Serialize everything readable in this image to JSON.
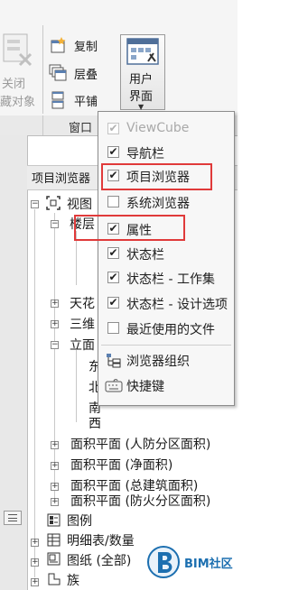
{
  "ribbon": {
    "close_hidden_line1": "关闭",
    "close_hidden_line2": "藏对象",
    "copy": "复制",
    "cascade": "层叠",
    "tile": "平铺",
    "ui_line1": "用户",
    "ui_line2": "界面",
    "panel_window": "窗口"
  },
  "browser": {
    "header": "项目浏览器",
    "items": {
      "views": "视图",
      "floor_plans_partial": "楼层",
      "ceiling_partial": "天花",
      "threeD_partial": "三维",
      "elevations_partial": "立面",
      "elev_e": "东",
      "elev_n": "北",
      "elev_s": "南",
      "elev_w": "西",
      "area_civil": "面积平面 (人防分区面积)",
      "area_net": "面积平面 (净面积)",
      "area_gross": "面积平面 (总建筑面积)",
      "area_fire": "面积平面 (防火分区面积)",
      "legends": "图例",
      "schedules": "明细表/数量",
      "sheets": "图纸 (全部)",
      "families": "族"
    }
  },
  "menu": {
    "items": [
      {
        "label": "ViewCube",
        "checked": true,
        "enabled": false
      },
      {
        "label": "导航栏",
        "checked": true,
        "enabled": true
      },
      {
        "label": "项目浏览器",
        "checked": true,
        "enabled": true
      },
      {
        "label": "系统浏览器",
        "checked": false,
        "enabled": true
      },
      {
        "label": "属性",
        "checked": true,
        "enabled": true
      },
      {
        "label": "状态栏",
        "checked": true,
        "enabled": true
      },
      {
        "label": "状态栏 - 工作集",
        "checked": true,
        "enabled": true
      },
      {
        "label": "状态栏 - 设计选项",
        "checked": true,
        "enabled": true
      },
      {
        "label": "最近使用的文件",
        "checked": false,
        "enabled": true
      }
    ],
    "browser_org": "浏览器组织",
    "shortcuts": "快捷键",
    "check_glyph": "✔"
  },
  "watermark": {
    "text": "BIM社区"
  },
  "colors": {
    "highlight": "#e03a3a",
    "logo_blue": "#1c6fb0"
  }
}
